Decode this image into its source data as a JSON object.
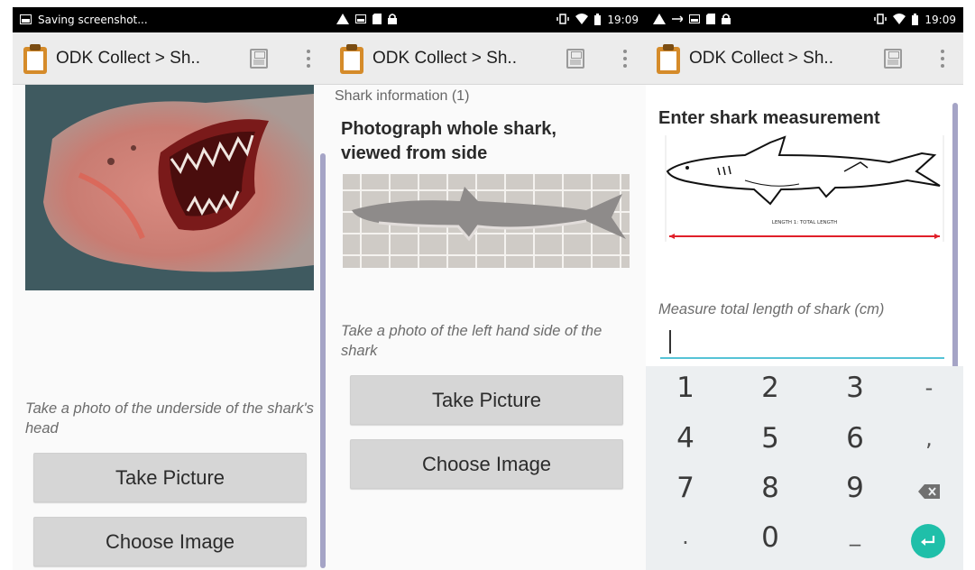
{
  "panels": [
    {
      "status": {
        "left_text": "Saving screenshot...",
        "time": ""
      },
      "toolbar": {
        "title": "ODK Collect > Sh.."
      },
      "hint": "Take a photo of the underside of the shark's head",
      "buttons": {
        "take": "Take Picture",
        "choose": "Choose Image"
      }
    },
    {
      "status": {
        "left_text": "",
        "time": "19:09"
      },
      "toolbar": {
        "title": "ODK Collect > Sh.."
      },
      "group_label": "Shark information (1)",
      "question": "Photograph whole shark, viewed from side",
      "hint": "Take a photo of the left hand side of the shark",
      "buttons": {
        "take": "Take Picture",
        "choose": "Choose Image"
      }
    },
    {
      "status": {
        "left_text": "",
        "time": "19:09"
      },
      "toolbar": {
        "title": "ODK Collect > Sh.."
      },
      "question": "Enter shark measurement",
      "diagram_label": "LENGTH 1: TOTAL LENGTH",
      "hint": "Measure total length of shark (cm)",
      "input_value": "",
      "keyboard": {
        "row1": [
          "1",
          "2",
          "3",
          "-"
        ],
        "row2": [
          "4",
          "5",
          "6",
          ","
        ],
        "row3": [
          "7",
          "8",
          "9"
        ],
        "row4": [
          ".",
          "0",
          "_"
        ]
      }
    }
  ],
  "colors": {
    "accent": "#1fbfa9",
    "scrollbar": "#a5a4c6",
    "measure_line": "#e0202a"
  },
  "icons": [
    "image-icon",
    "warning-icon",
    "sd-card-icon",
    "lock-icon",
    "vibrate-icon",
    "wifi-icon",
    "battery-icon",
    "clipboard-icon",
    "save-icon",
    "overflow-menu-icon",
    "backspace-icon",
    "enter-icon"
  ]
}
